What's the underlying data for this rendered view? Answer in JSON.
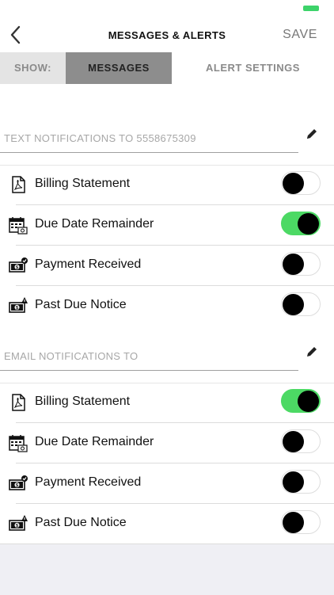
{
  "header": {
    "title": "MESSAGES & ALERTS",
    "save_label": "SAVE",
    "back_icon": "chevron-left-icon"
  },
  "segment": {
    "show_label": "SHOW:",
    "tabs": [
      {
        "label": "MESSAGES",
        "selected": true
      },
      {
        "label": "ALERT SETTINGS",
        "selected": false
      }
    ]
  },
  "sections": [
    {
      "label": "TEXT NOTIFICATIONS TO 5558675309",
      "edit_icon": "pencil-icon",
      "items": [
        {
          "label": "Billing Statement",
          "icon": "pdf-document-icon",
          "on": false
        },
        {
          "label": "Due Date Remainder",
          "icon": "calendar-dollar-icon",
          "on": true
        },
        {
          "label": "Payment Received",
          "icon": "money-check-icon",
          "on": false
        },
        {
          "label": "Past Due Notice",
          "icon": "money-warning-icon",
          "on": false
        }
      ]
    },
    {
      "label": "EMAIL NOTIFICATIONS TO",
      "edit_icon": "pencil-icon",
      "items": [
        {
          "label": "Billing Statement",
          "icon": "pdf-document-icon",
          "on": true
        },
        {
          "label": "Due Date Remainder",
          "icon": "calendar-dollar-icon",
          "on": false
        },
        {
          "label": "Payment Received",
          "icon": "money-check-icon",
          "on": false
        },
        {
          "label": "Past Due Notice",
          "icon": "money-warning-icon",
          "on": false
        }
      ]
    }
  ],
  "colors": {
    "toggle_on": "#4cd964",
    "segment_selected": "#8d8d8d",
    "battery": "#3dd36a"
  }
}
